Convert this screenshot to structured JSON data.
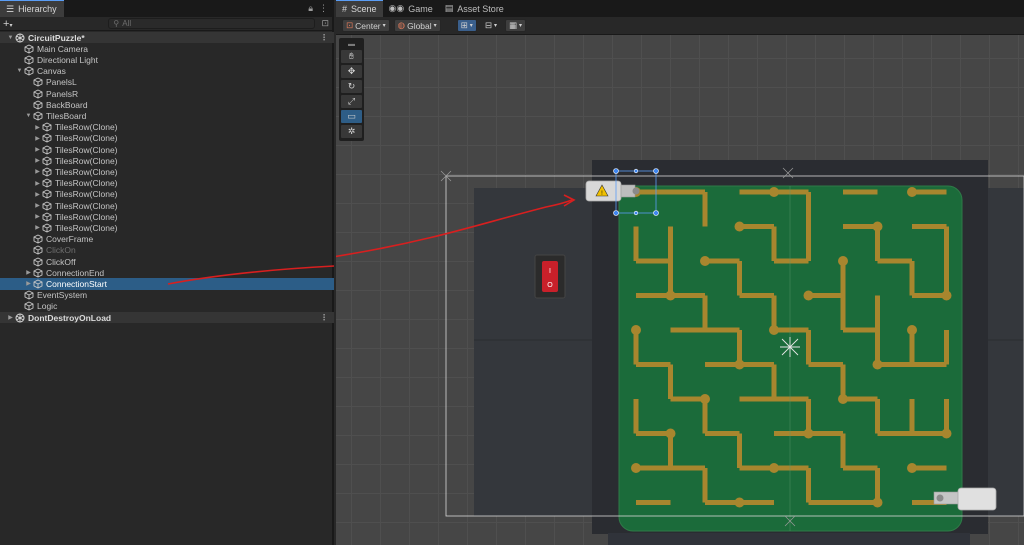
{
  "hierarchy": {
    "tab_label": "Hierarchy",
    "add_label": "+",
    "search_placeholder": "All",
    "items": [
      {
        "label": "CircuitPuzzle*",
        "kind": "scene",
        "depth": 0,
        "expanded": true
      },
      {
        "label": "Main Camera",
        "kind": "object",
        "depth": 1
      },
      {
        "label": "Directional Light",
        "kind": "object",
        "depth": 1
      },
      {
        "label": "Canvas",
        "kind": "object",
        "depth": 1,
        "expanded": true
      },
      {
        "label": "PanelsL",
        "kind": "object",
        "depth": 2
      },
      {
        "label": "PanelsR",
        "kind": "object",
        "depth": 2
      },
      {
        "label": "BackBoard",
        "kind": "object",
        "depth": 2
      },
      {
        "label": "TilesBoard",
        "kind": "object",
        "depth": 2,
        "expanded": true
      },
      {
        "label": "TilesRow(Clone)",
        "kind": "object",
        "depth": 3,
        "collapsed": true
      },
      {
        "label": "TilesRow(Clone)",
        "kind": "object",
        "depth": 3,
        "collapsed": true
      },
      {
        "label": "TilesRow(Clone)",
        "kind": "object",
        "depth": 3,
        "collapsed": true
      },
      {
        "label": "TilesRow(Clone)",
        "kind": "object",
        "depth": 3,
        "collapsed": true
      },
      {
        "label": "TilesRow(Clone)",
        "kind": "object",
        "depth": 3,
        "collapsed": true
      },
      {
        "label": "TilesRow(Clone)",
        "kind": "object",
        "depth": 3,
        "collapsed": true
      },
      {
        "label": "TilesRow(Clone)",
        "kind": "object",
        "depth": 3,
        "collapsed": true
      },
      {
        "label": "TilesRow(Clone)",
        "kind": "object",
        "depth": 3,
        "collapsed": true
      },
      {
        "label": "TilesRow(Clone)",
        "kind": "object",
        "depth": 3,
        "collapsed": true
      },
      {
        "label": "TilesRow(Clone)",
        "kind": "object",
        "depth": 3,
        "collapsed": true
      },
      {
        "label": "CoverFrame",
        "kind": "object",
        "depth": 2
      },
      {
        "label": "ClickOn",
        "kind": "object",
        "depth": 2,
        "dim": true
      },
      {
        "label": "ClickOff",
        "kind": "object",
        "depth": 2
      },
      {
        "label": "ConnectionEnd",
        "kind": "object",
        "depth": 2,
        "collapsed": true
      },
      {
        "label": "ConnectionStart",
        "kind": "object",
        "depth": 2,
        "collapsed": true,
        "selected": true
      },
      {
        "label": "EventSystem",
        "kind": "object",
        "depth": 1
      },
      {
        "label": "Logic",
        "kind": "object",
        "depth": 1
      },
      {
        "label": "DontDestroyOnLoad",
        "kind": "scene",
        "depth": 0,
        "collapsed": true
      }
    ]
  },
  "scene_view": {
    "tabs": [
      {
        "label": "Scene",
        "icon": "grid-icon",
        "active": true
      },
      {
        "label": "Game",
        "icon": "gamepad-icon",
        "active": false
      },
      {
        "label": "Asset Store",
        "icon": "store-icon",
        "active": false
      }
    ],
    "pivot_label": "Center",
    "space_label": "Global",
    "switch_label_on": "I",
    "switch_label_off": "O",
    "warning_symbol": "!"
  },
  "colors": {
    "board_green": "#1b6b3a",
    "wire_gold": "#a8862e",
    "selection_blue": "#2c5d87",
    "annotation_red": "#d81f1f"
  }
}
